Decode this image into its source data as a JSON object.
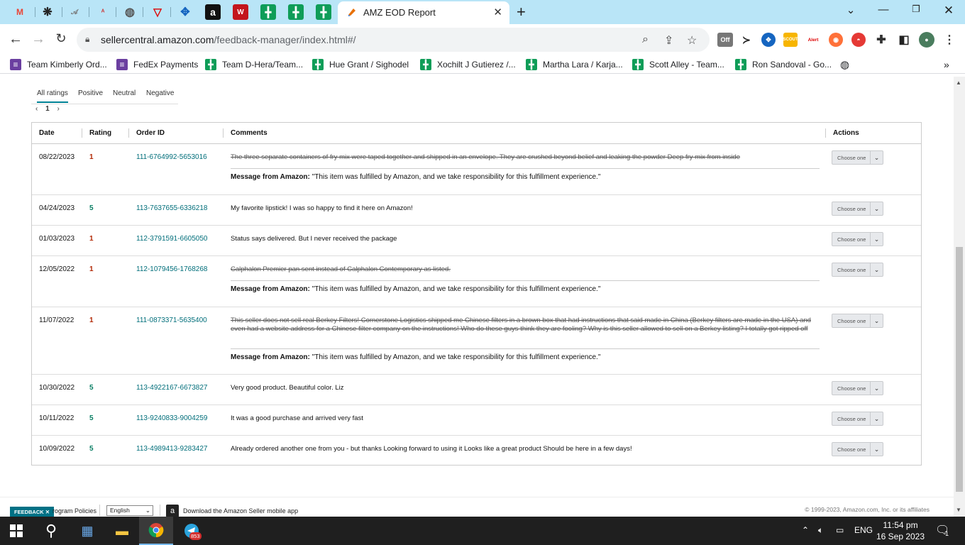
{
  "browser": {
    "active_tab_title": "AMZ EOD Report",
    "url_host": "sellercentral.amazon.com",
    "url_path": "/feedback-manager/index.html#/",
    "bookmarks": [
      "Team Kimberly Ord...",
      "FedEx Payments",
      "Team D-Hera/Team...",
      "Hue Grant / Sighodel",
      "Xochilt J Gutierez /...",
      "Martha Lara / Karja...",
      "Scott Alley - Team...",
      "Ron Sandoval - Go..."
    ],
    "extension_badges": {
      "off": "Off",
      "scout": "SCOUT",
      "alert": "Alert"
    }
  },
  "filters": {
    "tabs": [
      "All ratings",
      "Positive",
      "Neutral",
      "Negative"
    ],
    "active": "All ratings"
  },
  "pager": {
    "prev": "‹",
    "page": "1",
    "next": "›"
  },
  "table": {
    "headers": {
      "date": "Date",
      "rating": "Rating",
      "order": "Order ID",
      "comments": "Comments",
      "actions": "Actions"
    },
    "action_label": "Choose one",
    "message_prefix": "Message from Amazon:",
    "message_text": "\"This item was fulfilled by Amazon, and we take responsibility for this fulfillment experience.\"",
    "rows": [
      {
        "date": "08/22/2023",
        "rating": "1",
        "order": "111-6764992-5653016",
        "comment": "The three separate containers of fry mix were taped together and shipped in an envelope. They are crushed beyond belief and leaking the powder Deep fry mix from inside",
        "struck": true
      },
      {
        "date": "04/24/2023",
        "rating": "5",
        "order": "113-7637655-6336218",
        "comment": "My favorite lipstick! I was so happy to find it here on Amazon!",
        "struck": false
      },
      {
        "date": "01/03/2023",
        "rating": "1",
        "order": "112-3791591-6605050",
        "comment": "Status says delivered. But I never received the package",
        "struck": false
      },
      {
        "date": "12/05/2022",
        "rating": "1",
        "order": "112-1079456-1768268",
        "comment": "Calphalon Premier pan sent instead of Calphalon Contemporary as listed.",
        "struck": true
      },
      {
        "date": "11/07/2022",
        "rating": "1",
        "order": "111-0873371-5635400",
        "comment": "This seller does not sell real Berkey Filters! Cornerstone Logistics shipped me Chinese filters in a brown box that had instructions that said made in China (Berkey filters are made in the USA) and even had a website address for a Chinese filter company on the instructions! Who do these guys think they are fooling? Why is this seller allowed to sell on a Berkey listing? I totally got ripped off",
        "struck": true
      },
      {
        "date": "10/30/2022",
        "rating": "5",
        "order": "113-4922167-6673827",
        "comment": "Very good product. Beautiful color. Liz",
        "struck": false
      },
      {
        "date": "10/11/2022",
        "rating": "5",
        "order": "113-9240833-9004259",
        "comment": "It was a good purchase and arrived very fast",
        "struck": false
      },
      {
        "date": "10/09/2022",
        "rating": "5",
        "order": "113-4989413-9283427",
        "comment": "Already ordered another one from you - but thanks Looking forward to using it Looks like a great product Should be here in a few days!",
        "struck": false
      }
    ]
  },
  "footer": {
    "feedback": "FEEDBACK",
    "feedback_close": "✕",
    "policies": "rogram Policies",
    "language": "English",
    "app_link": "Download the Amazon Seller mobile app",
    "copyright": "© 1999-2023, Amazon.com, Inc. or its affiliates"
  },
  "taskbar": {
    "telegram_badge": "853",
    "lang": "ENG",
    "time": "11:54 pm",
    "date": "16 Sep 2023",
    "notif_count": "1"
  }
}
